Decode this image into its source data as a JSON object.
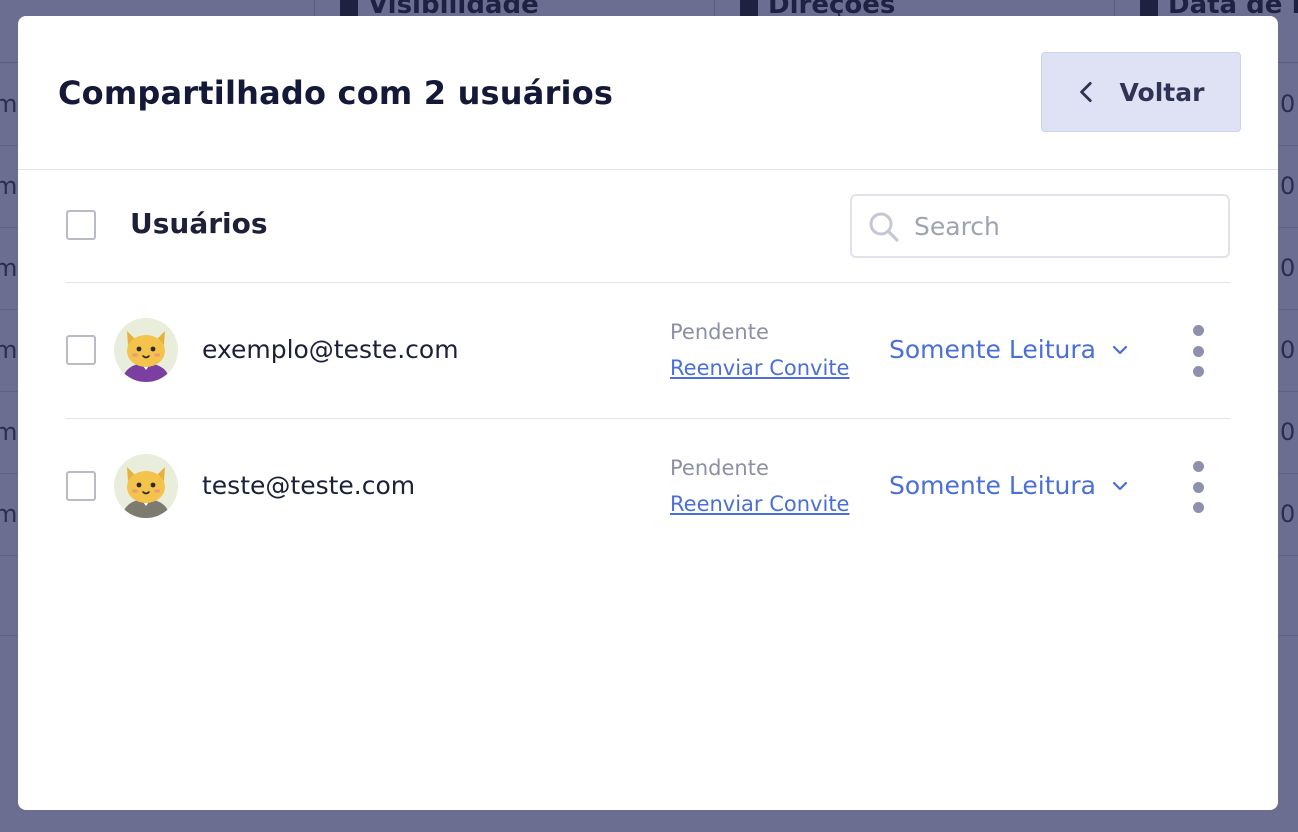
{
  "background": {
    "columns": [
      {
        "label": "Visibilidade",
        "icon": "visibility-icon"
      },
      {
        "label": "Direções",
        "icon": "document-icon"
      },
      {
        "label": "Data de Re",
        "icon": "calendar-icon"
      }
    ],
    "row_left_chars": [
      "m",
      "m",
      "m",
      "m",
      "m",
      "m"
    ],
    "row_right_chars": [
      "0",
      "0",
      "0",
      "0",
      "0",
      "0"
    ]
  },
  "modal": {
    "title": "Compartilhado com 2 usuários",
    "back_button": {
      "label": "Voltar",
      "icon": "chevron-left-icon"
    },
    "section_label": "Usuários",
    "search": {
      "placeholder": "Search",
      "value": "",
      "icon": "search-icon"
    },
    "users": [
      {
        "email": "exemplo@teste.com",
        "status": "Pendente",
        "resend_label": "Reenviar Convite",
        "permission": "Somente Leitura",
        "avatar_shirt": "#7a3fa0"
      },
      {
        "email": "teste@teste.com",
        "status": "Pendente",
        "resend_label": "Reenviar Convite",
        "permission": "Somente Leitura",
        "avatar_shirt": "#7d7a70"
      }
    ]
  },
  "colors": {
    "overlay": "#6b6e90",
    "accent_link": "#4a6fd6",
    "back_button_bg": "#dfe2f4",
    "title_text": "#141938"
  }
}
